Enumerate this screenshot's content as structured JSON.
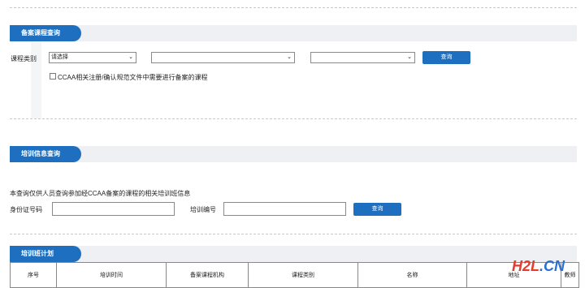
{
  "sections": {
    "course_query": {
      "title": "备案课程查询",
      "category_label": "课程类别",
      "select1_value": "请选择",
      "select2_value": "",
      "select3_value": "",
      "query_button": "查询",
      "checkbox_label": "CCAA相关注册/确认规范文件中需要进行备案的课程"
    },
    "training_query": {
      "title": "培训信息查询",
      "note": "本查询仅供人员查询参加经CCAA备案的课程的相关培训班信息",
      "id_label": "身份证号码",
      "train_no_label": "培训编号",
      "query_button": "查询"
    },
    "plan": {
      "title": "培训班计划",
      "columns": [
        "序号",
        "培训时间",
        "备案课程机构",
        "课程类别",
        "名称",
        "地址",
        "教师"
      ]
    }
  },
  "watermark": {
    "part1": "H2L",
    "part2": ".CN"
  }
}
